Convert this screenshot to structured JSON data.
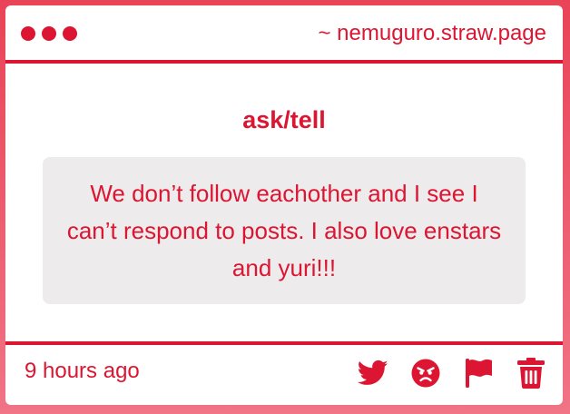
{
  "window": {
    "site": "~ nemuguro.straw.page"
  },
  "post": {
    "heading": "ask/tell",
    "message": "We don’t follow eachother and I see I can’t respond to posts. I also love enstars and yuri!!!"
  },
  "footer": {
    "timestamp": "9 hours ago",
    "actions": [
      "twitter-icon",
      "angry-face-icon",
      "flag-icon",
      "trash-icon"
    ]
  },
  "colors": {
    "accent": "#dc1632",
    "background": "#ee4f63",
    "message_bg": "#edebec"
  }
}
